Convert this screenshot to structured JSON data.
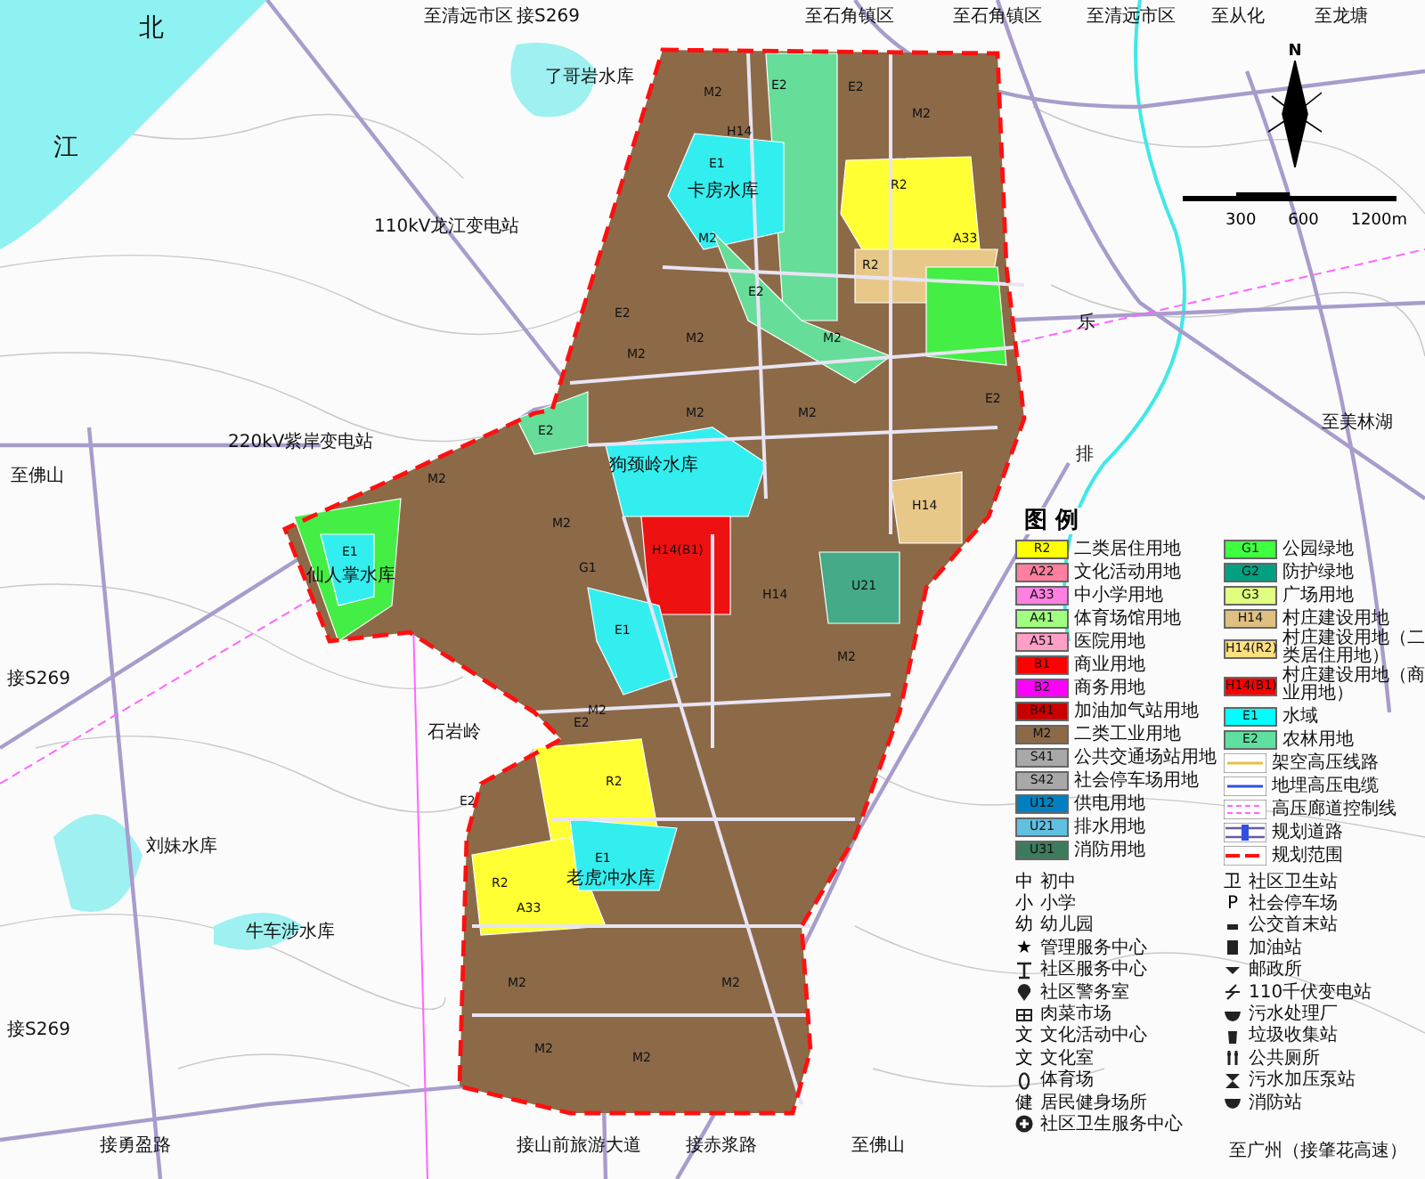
{
  "map": {
    "place_labels": [
      {
        "text": "至清远市区"
      },
      {
        "text": "接S269"
      },
      {
        "text": "至石角镇区"
      },
      {
        "text": "至石角镇区"
      },
      {
        "text": "至清远市区"
      },
      {
        "text": "至从化"
      },
      {
        "text": "至龙塘"
      },
      {
        "text": "北"
      },
      {
        "text": "江"
      },
      {
        "text": "了哥岩水库"
      },
      {
        "text": "110kV龙江变电站"
      },
      {
        "text": "卡房水库"
      },
      {
        "text": "220kV紫岸变电站"
      },
      {
        "text": "至佛山"
      },
      {
        "text": "至美林湖"
      },
      {
        "text": "仙人掌水库"
      },
      {
        "text": "狗颈岭水库"
      },
      {
        "text": "接S269"
      },
      {
        "text": "石岩岭"
      },
      {
        "text": "刘妹水库"
      },
      {
        "text": "牛车涉水库"
      },
      {
        "text": "接S269"
      },
      {
        "text": "接勇盈路"
      },
      {
        "text": "接山前旅游大道"
      },
      {
        "text": "接赤浆路"
      },
      {
        "text": "至佛山"
      },
      {
        "text": "老虎冲水库"
      },
      {
        "text": "至广州（接肇花高速）"
      },
      {
        "text": "乐"
      },
      {
        "text": "排"
      }
    ],
    "zones": [
      {
        "code": "M2"
      },
      {
        "code": "M2"
      },
      {
        "code": "M2"
      },
      {
        "code": "M2"
      },
      {
        "code": "M2"
      },
      {
        "code": "M2"
      },
      {
        "code": "M2"
      },
      {
        "code": "M2"
      },
      {
        "code": "M2"
      },
      {
        "code": "M2"
      },
      {
        "code": "M2"
      },
      {
        "code": "M2"
      },
      {
        "code": "M2"
      },
      {
        "code": "M2"
      },
      {
        "code": "M2"
      },
      {
        "code": "M2"
      },
      {
        "code": "E2"
      },
      {
        "code": "E2"
      },
      {
        "code": "E2"
      },
      {
        "code": "E2"
      },
      {
        "code": "E2"
      },
      {
        "code": "E2"
      },
      {
        "code": "E2"
      },
      {
        "code": "E2"
      },
      {
        "code": "E1"
      },
      {
        "code": "E1"
      },
      {
        "code": "E1"
      },
      {
        "code": "E1"
      },
      {
        "code": "R2"
      },
      {
        "code": "R2"
      },
      {
        "code": "R2"
      },
      {
        "code": "R2"
      },
      {
        "code": "H14"
      },
      {
        "code": "H14"
      },
      {
        "code": "H14"
      },
      {
        "code": "U21"
      },
      {
        "code": "G1"
      },
      {
        "code": "H14(B1)"
      },
      {
        "code": "A33"
      },
      {
        "code": "A33"
      }
    ],
    "compass": {
      "letter": "N"
    },
    "scale": {
      "labels": [
        "300",
        "600",
        "1200m"
      ]
    }
  },
  "legend": {
    "title": "图 例",
    "land_use_left": [
      {
        "code": "R2",
        "name": "二类居住用地",
        "color": "#ffff00"
      },
      {
        "code": "A22",
        "name": "文化活动用地",
        "color": "#ff7f9f"
      },
      {
        "code": "A33",
        "name": "中小学用地",
        "color": "#ff80e0"
      },
      {
        "code": "A41",
        "name": "体育场馆用地",
        "color": "#a0ff80"
      },
      {
        "code": "A51",
        "name": "医院用地",
        "color": "#ff9fc8"
      },
      {
        "code": "B1",
        "name": "商业用地",
        "color": "#ff0000"
      },
      {
        "code": "B2",
        "name": "商务用地",
        "color": "#ff00ff"
      },
      {
        "code": "B41",
        "name": "加油加气站用地",
        "color": "#c80000"
      },
      {
        "code": "M2",
        "name": "二类工业用地",
        "color": "#8c6a48"
      },
      {
        "code": "S41",
        "name": "公共交通场站用地",
        "color": "#a8a8a8"
      },
      {
        "code": "S42",
        "name": "社会停车场用地",
        "color": "#a8a8a8"
      },
      {
        "code": "U12",
        "name": "供电用地",
        "color": "#0080c0"
      },
      {
        "code": "U21",
        "name": "排水用地",
        "color": "#60c0e0"
      },
      {
        "code": "U31",
        "name": "消防用地",
        "color": "#3c7c5c"
      }
    ],
    "land_use_right": [
      {
        "code": "G1",
        "name": "公园绿地",
        "color": "#40ff40"
      },
      {
        "code": "G2",
        "name": "防护绿地",
        "color": "#00a080"
      },
      {
        "code": "G3",
        "name": "广场用地",
        "color": "#e0ff80"
      },
      {
        "code": "H14",
        "name": "村庄建设用地",
        "color": "#e0c080"
      },
      {
        "code": "H14(R2)",
        "name": "村庄建设用地（二类居住用地）",
        "color": "#ffe080"
      },
      {
        "code": "H14(B1)",
        "name": "村庄建设用地（商业用地）",
        "color": "#ff0000"
      },
      {
        "code": "E1",
        "name": "水域",
        "color": "#00ffff"
      },
      {
        "code": "E2",
        "name": "农林用地",
        "color": "#60e0a0"
      }
    ],
    "lines": [
      {
        "kind": "overhead",
        "name": "架空高压线路"
      },
      {
        "kind": "cable",
        "name": "地埋高压电缆"
      },
      {
        "kind": "corridor",
        "name": "高压廊道控制线"
      },
      {
        "kind": "road",
        "name": "规划道路"
      },
      {
        "kind": "boundary",
        "name": "规划范围"
      }
    ],
    "facilities_left": [
      {
        "symbol": "中",
        "name": "初中"
      },
      {
        "symbol": "小",
        "name": "小学"
      },
      {
        "symbol": "幼",
        "name": "幼儿园"
      },
      {
        "symbol": "★",
        "name": "管理服务中心"
      },
      {
        "kind": "tower",
        "name": "社区服务中心"
      },
      {
        "kind": "pin",
        "name": "社区警务室"
      },
      {
        "kind": "grid",
        "name": "肉菜市场"
      },
      {
        "symbol": "文",
        "name": "文化活动中心"
      },
      {
        "symbol": "文",
        "name": "文化室"
      },
      {
        "kind": "oval",
        "name": "体育场"
      },
      {
        "symbol": "健",
        "name": "居民健身场所"
      },
      {
        "kind": "cross",
        "name": "社区卫生服务中心"
      }
    ],
    "facilities_right": [
      {
        "symbol": "卫",
        "name": "社区卫生站"
      },
      {
        "symbol": "P",
        "name": "社会停车场"
      },
      {
        "kind": "bus",
        "name": "公交首末站"
      },
      {
        "kind": "fuel",
        "name": "加油站"
      },
      {
        "kind": "post",
        "name": "邮政所"
      },
      {
        "kind": "bolt",
        "name": "110千伏变电站"
      },
      {
        "kind": "bowl",
        "name": "污水处理厂"
      },
      {
        "kind": "bin",
        "name": "垃圾收集站"
      },
      {
        "kind": "toilet",
        "name": "公共厕所"
      },
      {
        "kind": "hourglass",
        "name": "污水加压泵站"
      },
      {
        "kind": "bowl",
        "name": "消防站"
      }
    ]
  }
}
